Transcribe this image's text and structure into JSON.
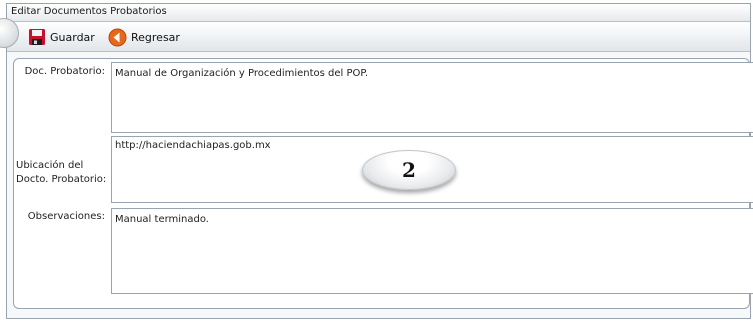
{
  "window": {
    "title": "Editar Documentos Probatorios"
  },
  "toolbar": {
    "save_label": "Guardar",
    "save_icon": "floppy-disk-icon",
    "back_label": "Regresar",
    "back_icon": "back-arrow-icon"
  },
  "form": {
    "doc_label": "Doc. Probatorio:",
    "doc_value": "Manual de Organización y Procedimientos del POP.",
    "ubicacion_label": "Ubicación del Docto. Probatorio:",
    "ubicacion_value": "http://haciendachiapas.gob.mx",
    "obs_label": "Observaciones:",
    "obs_value": "Manual terminado."
  },
  "callout": {
    "number": "2"
  },
  "colors": {
    "save_icon_red": "#c8102e",
    "back_icon_orange": "#e8681a",
    "border": "#9aa4ae"
  }
}
